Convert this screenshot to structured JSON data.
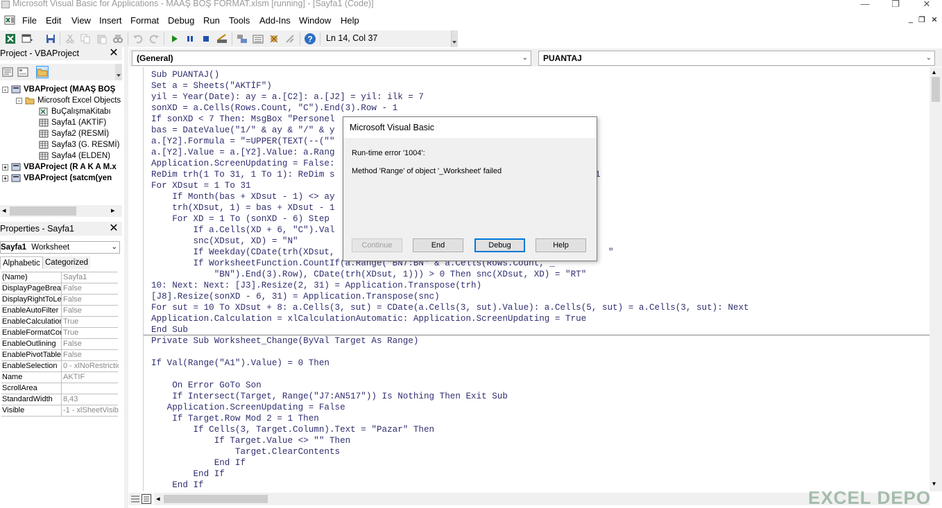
{
  "window": {
    "title": "Microsoft Visual Basic for Applications - MAAŞ BOŞ FORMAT.xlsm [running] - [Sayfa1 (Code)]",
    "minimize": "—",
    "maximize": "❐",
    "close": "✕"
  },
  "menu": {
    "items": [
      "File",
      "Edit",
      "View",
      "Insert",
      "Format",
      "Debug",
      "Run",
      "Tools",
      "Add-Ins",
      "Window",
      "Help"
    ],
    "mdi_minimize": "_",
    "mdi_restore": "❐",
    "mdi_close": "✕"
  },
  "toolbar": {
    "position": "Ln 14, Col 37"
  },
  "project_pane": {
    "title": "Project - VBAProject",
    "close": "✕",
    "tree": [
      {
        "label": "VBAProject (MAAŞ BOŞ",
        "bold": true,
        "expander": "-",
        "level": 0,
        "icon": "vbaproject-icon"
      },
      {
        "label": "Microsoft Excel Objects",
        "bold": false,
        "expander": "-",
        "level": 1,
        "icon": "folder-icon"
      },
      {
        "label": "BuÇalışmaKitabı",
        "bold": false,
        "expander": "",
        "level": 2,
        "icon": "workbook-icon"
      },
      {
        "label": "Sayfa1 (AKTİF)",
        "bold": false,
        "expander": "",
        "level": 2,
        "icon": "sheet-icon"
      },
      {
        "label": "Sayfa2 (RESMİ)",
        "bold": false,
        "expander": "",
        "level": 2,
        "icon": "sheet-icon"
      },
      {
        "label": "Sayfa3 (G. RESMİ)",
        "bold": false,
        "expander": "",
        "level": 2,
        "icon": "sheet-icon"
      },
      {
        "label": "Sayfa4 (ELDEN)",
        "bold": false,
        "expander": "",
        "level": 2,
        "icon": "sheet-icon"
      },
      {
        "label": "VBAProject (R A K A M.x",
        "bold": true,
        "expander": "+",
        "level": 0,
        "icon": "vbaproject-icon"
      },
      {
        "label": "VBAProject (satcm(yen",
        "bold": true,
        "expander": "+",
        "level": 0,
        "icon": "vbaproject-icon"
      }
    ]
  },
  "properties_pane": {
    "title": "Properties - Sayfa1",
    "close": "✕",
    "object_name": "Sayfa1",
    "object_type": "Worksheet",
    "tabs": [
      "Alphabetic",
      "Categorized"
    ],
    "rows": [
      {
        "name": "(Name)",
        "value": "Sayfa1"
      },
      {
        "name": "DisplayPageBreak",
        "value": "False"
      },
      {
        "name": "DisplayRightToLef",
        "value": "False"
      },
      {
        "name": "EnableAutoFilter",
        "value": "False"
      },
      {
        "name": "EnableCalculation",
        "value": "True"
      },
      {
        "name": "EnableFormatCon",
        "value": "True"
      },
      {
        "name": "EnableOutlining",
        "value": "False"
      },
      {
        "name": "EnablePivotTable",
        "value": "False"
      },
      {
        "name": "EnableSelection",
        "value": "0 - xlNoRestrictio"
      },
      {
        "name": "Name",
        "value": "AKTIF"
      },
      {
        "name": "ScrollArea",
        "value": ""
      },
      {
        "name": "StandardWidth",
        "value": "8,43"
      },
      {
        "name": "Visible",
        "value": "-1 - xlSheetVisib"
      }
    ]
  },
  "code_window": {
    "object_combo": "(General)",
    "proc_combo": "PUANTAJ",
    "lines": [
      "Sub PUANTAJ()",
      "Set a = Sheets(\"AKTİF\")",
      "yil = Year(Date): ay = a.[C2]: a.[J2] = yil: ilk = 7",
      "sonXD = a.Cells(Rows.Count, \"C\").End(3).Row - 1",
      "If sonXD < 7 Then: MsgBox \"Personel",
      "bas = DateValue(\"1/\" & ay & \"/\" & y",
      "a.[Y2].Formula = \"=UPPER(TEXT(--(\"\"",
      "a.[Y2].Value = a.[Y2].Value: a.Rang",
      "Application.ScreenUpdating = False:",
      "ReDim trh(1 To 31, 1 To 1): ReDim s",
      "For XDsut = 1 To 31",
      "    If Month(bas + XDsut - 1) <> ay",
      "    trh(XDsut, 1) = bas + XDsut - 1",
      "    For XD = 1 To (sonXD - 6) Step",
      "        If a.Cells(XD + 6, \"C\").Val",
      "        snc(XDsut, XD) = \"N\"",
      "        If Weekday(CDate(trh(XDsut,",
      "        If WorksheetFunction.CountIf(a.Range(\"BN7:BN\" & a.Cells(Rows.Count, _",
      "            \"BN\").End(3).Row), CDate(trh(XDsut, 1))) > 0 Then snc(XDsut, XD) = \"RT\"",
      "10: Next: Next: [J3].Resize(2, 31) = Application.Transpose(trh)",
      "[J8].Resize(sonXD - 6, 31) = Application.Transpose(snc)",
      "For sut = 10 To XDsut + 8: a.Cells(3, sut) = CDate(a.Cells(3, sut).Value): a.Cells(5, sut) = a.Cells(3, sut): Next",
      "Application.Calculation = xlCalculationAutomatic: Application.ScreenUpdating = True",
      "End Sub",
      "Private Sub Worksheet_Change(ByVal Target As Range)",
      "",
      "If Val(Range(\"A1\").Value) = 0 Then",
      "",
      "    On Error GoTo Son",
      "    If Intersect(Target, Range(\"J7:AN517\")) Is Nothing Then Exit Sub",
      "   Application.ScreenUpdating = False",
      "    If Target.Row Mod 2 = 1 Then",
      "        If Cells(3, Target.Column).Text = \"Pazar\" Then",
      "            If Target.Value <> \"\" Then",
      "                Target.ClearContents",
      "            End If",
      "        End If",
      "    End If"
    ],
    "right_fragments": [
      {
        "line": 9,
        "text": "1"
      },
      {
        "line": 16,
        "text": "\""
      }
    ]
  },
  "dialog": {
    "title": "Microsoft Visual Basic",
    "error_line": "Run-time error '1004':",
    "message": "Method 'Range' of object '_Worksheet' failed",
    "buttons": {
      "continue": "Continue",
      "end": "End",
      "debug": "Debug",
      "help": "Help"
    }
  },
  "watermark": "EXCEL DEPO"
}
